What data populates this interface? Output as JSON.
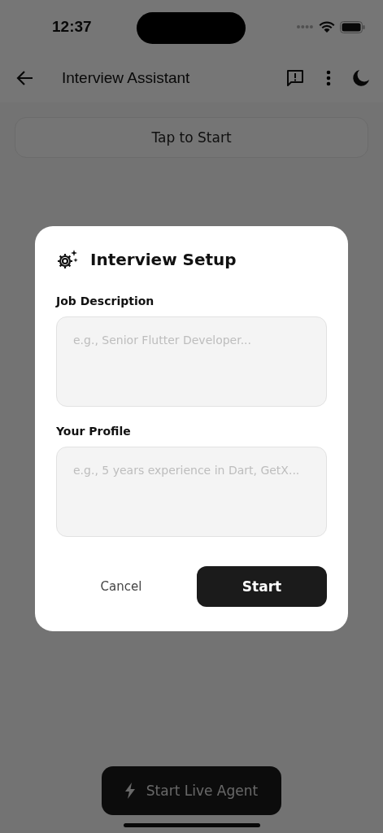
{
  "status_bar": {
    "time": "12:37"
  },
  "app_bar": {
    "title": "Interview Assistant"
  },
  "tap_button": {
    "label": "Tap to Start"
  },
  "live_button": {
    "label": "Start Live Agent"
  },
  "dialog": {
    "title": "Interview Setup",
    "fields": [
      {
        "label": "Job Description",
        "placeholder": "e.g., Senior Flutter Developer..."
      },
      {
        "label": "Your Profile",
        "placeholder": "e.g., 5 years experience in Dart, GetX..."
      }
    ],
    "cancel": "Cancel",
    "confirm": "Start"
  }
}
